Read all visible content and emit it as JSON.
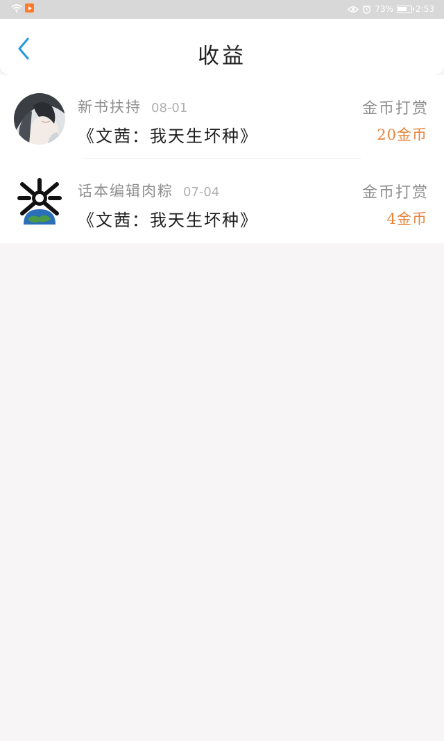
{
  "status_bar": {
    "battery": "73%",
    "time": "2:53",
    "wifi_icon": "wifi-icon",
    "eye_icon": "eye-icon",
    "alarm_icon": "alarm-icon"
  },
  "header": {
    "title": "收益",
    "back_icon": "chevron-left-icon"
  },
  "accent_color": "#e8843c",
  "items": [
    {
      "from": "新书扶持",
      "date": "08-01",
      "type": "金币打赏",
      "book": "《文茜：我天生坏种》",
      "amount": "20金币"
    },
    {
      "from": "话本编辑肉粽",
      "date": "07-04",
      "type": "金币打赏",
      "book": "《文茜：我天生坏种》",
      "amount": "4金币"
    }
  ]
}
